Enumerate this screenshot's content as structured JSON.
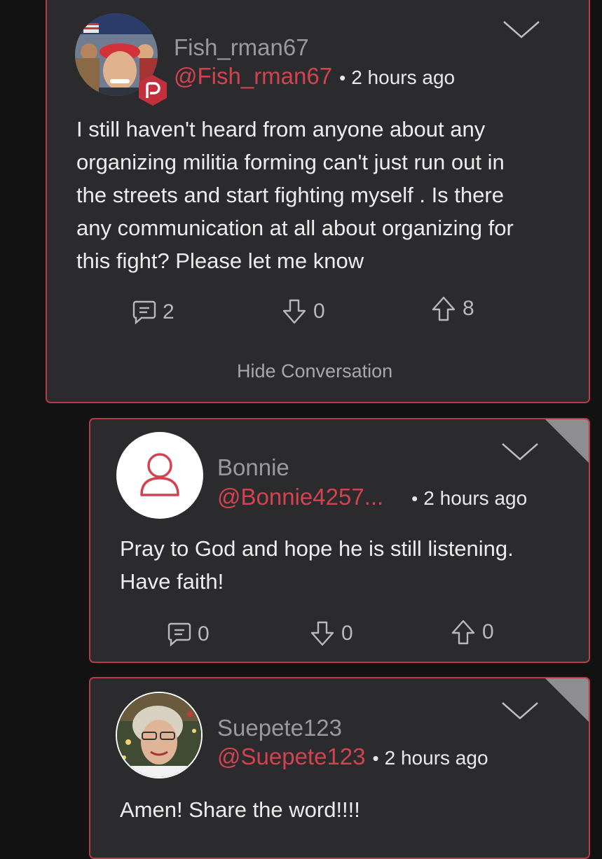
{
  "colors": {
    "background": "#121212",
    "card": "#2b2b2d",
    "accent": "#d2424f",
    "border": "#b83a44"
  },
  "posts": [
    {
      "display_name": "Fish_rman67",
      "handle": "@Fish_rman67",
      "separator": "•",
      "time": "2 hours ago",
      "body_lines": [
        "I still haven't heard from anyone about any",
        "organizing militia forming can't just run out in",
        "the streets and start fighting myself . Is there",
        "any communication at all about organizing for",
        "this fight? Please let me know"
      ],
      "comments": "2",
      "downvotes": "0",
      "upvotes": "8",
      "hide_conversation": "Hide Conversation",
      "avatar": "user-photo",
      "badge_icon": "parler-badge-icon"
    },
    {
      "display_name": "Bonnie",
      "handle": "@Bonnie4257...",
      "separator": "•",
      "time": "2 hours ago",
      "body_lines": [
        "Pray to God and hope he is still listening.",
        "Have faith!"
      ],
      "comments": "0",
      "downvotes": "0",
      "upvotes": "0",
      "avatar": "default-user-icon"
    },
    {
      "display_name": "Suepete123",
      "handle": "@Suepete123",
      "separator": "•",
      "time": "2 hours ago",
      "body_lines": [
        "Amen! Share the word!!!!"
      ],
      "avatar": "user-photo"
    }
  ]
}
